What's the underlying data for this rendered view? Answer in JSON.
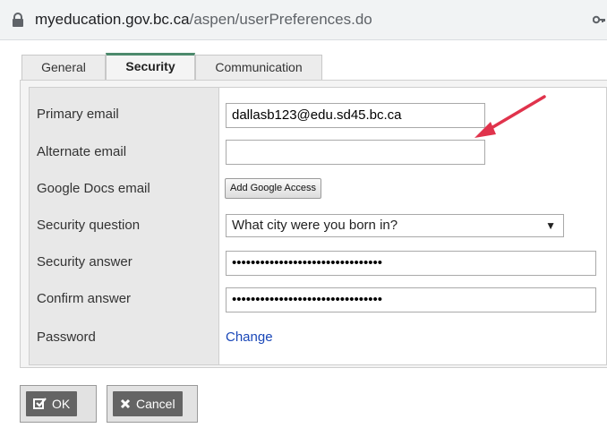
{
  "browser": {
    "url_domain": "myeducation.gov.bc.ca",
    "url_path": "/aspen/userPreferences.do"
  },
  "tabs": [
    {
      "label": "General",
      "active": false
    },
    {
      "label": "Security",
      "active": true
    },
    {
      "label": "Communication",
      "active": false
    }
  ],
  "form": {
    "primary_email_label": "Primary email",
    "primary_email_value": "dallasb123@edu.sd45.bc.ca",
    "alternate_email_label": "Alternate email",
    "alternate_email_value": "",
    "google_docs_label": "Google Docs email",
    "google_access_button": "Add Google Access",
    "security_question_label": "Security question",
    "security_question_value": "What city were you born in?",
    "security_answer_label": "Security answer",
    "security_answer_value": "••••••••••••••••••••••••••••••••",
    "confirm_answer_label": "Confirm answer",
    "confirm_answer_value": "••••••••••••••••••••••••••••••••",
    "password_label": "Password",
    "password_change_link": "Change"
  },
  "buttons": {
    "ok_label": "OK",
    "cancel_label": "Cancel"
  },
  "colors": {
    "active_tab_accent": "#4c8a6c",
    "link": "#1a47b8",
    "annotation_arrow": "#e0334c"
  },
  "icons": {
    "lock": "lock-icon",
    "key": "key-icon",
    "ok": "checkbox-icon",
    "cancel": "x-icon"
  }
}
